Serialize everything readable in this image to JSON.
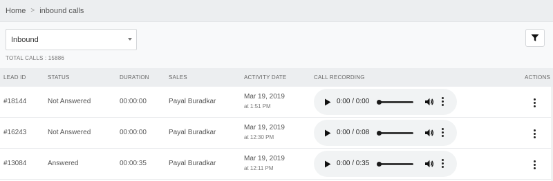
{
  "breadcrumb": {
    "home": "Home",
    "separator": ">",
    "current": "inbound calls"
  },
  "filter": {
    "selected": "Inbound",
    "total_calls": "TOTAL CALLS : 15886"
  },
  "table": {
    "headers": {
      "lead_id": "LEAD ID",
      "status": "STATUS",
      "duration": "DURATION",
      "sales": "SALES",
      "activity_date": "ACTIVITY DATE",
      "call_recording": "CALL RECORDING",
      "actions": "ACTIONS"
    },
    "rows": [
      {
        "lead_id": "#18144",
        "status": "Not Answered",
        "duration": "00:00:00",
        "sales": "Payal Buradkar",
        "date": "Mar 19, 2019",
        "time": "at 1:51 PM",
        "recording_time": "0:00 / 0:00"
      },
      {
        "lead_id": "#16243",
        "status": "Not Answered",
        "duration": "00:00:00",
        "sales": "Payal Buradkar",
        "date": "Mar 19, 2019",
        "time": "at 12:30 PM",
        "recording_time": "0:00 / 0:08"
      },
      {
        "lead_id": "#13084",
        "status": "Answered",
        "duration": "00:00:35",
        "sales": "Payal Buradkar",
        "date": "Mar 19, 2019",
        "time": "at 12:11 PM",
        "recording_time": "0:00 / 0:35"
      }
    ]
  }
}
